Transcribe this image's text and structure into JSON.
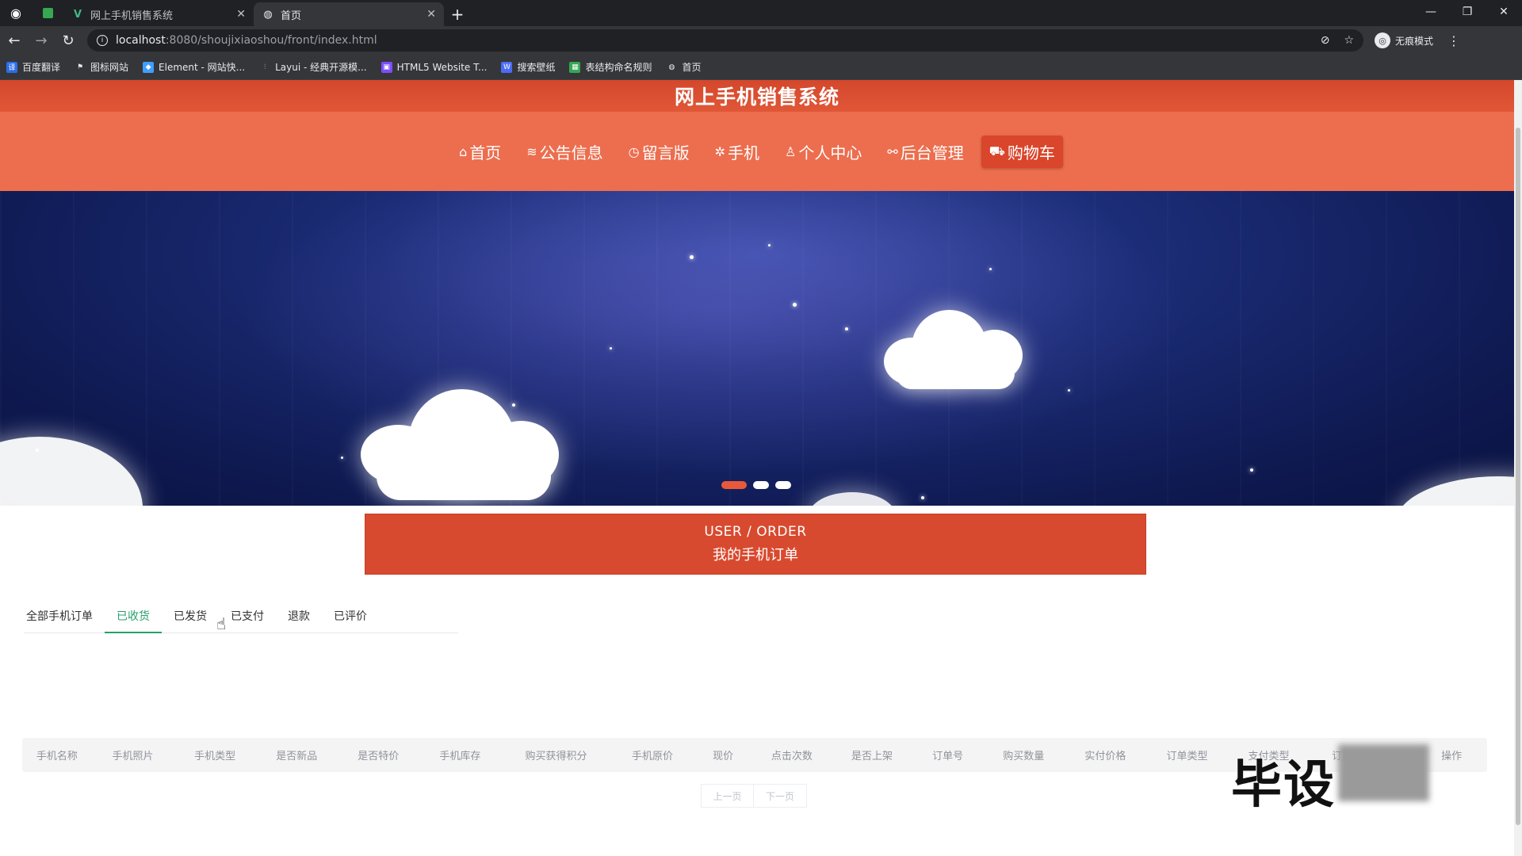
{
  "browser": {
    "tabs": [
      {
        "title": "网上手机销售系统",
        "active": false
      },
      {
        "title": "首页",
        "active": true
      }
    ],
    "url_host": "localhost",
    "url_path": ":8080/shoujixiaoshou/front/index.html",
    "profile_label": "无痕模式",
    "bookmarks": [
      {
        "label": "百度翻译",
        "color": "#2b6de8"
      },
      {
        "label": "图标网站",
        "color": "#e8eaed"
      },
      {
        "label": "Element - 网站快...",
        "color": "#409eff"
      },
      {
        "label": "Layui - 经典开源模...",
        "color": "#5f6368"
      },
      {
        "label": "HTML5 Website T...",
        "color": "#7c4dff"
      },
      {
        "label": "搜索壁纸",
        "color": "#4a6cf7"
      },
      {
        "label": "表结构命名规则",
        "color": "#34a853"
      },
      {
        "label": "首页",
        "color": "#e8eaed"
      }
    ]
  },
  "site": {
    "title": "网上手机销售系统",
    "nav": [
      {
        "icon": "⌂",
        "label": "首页"
      },
      {
        "icon": "≋",
        "label": "公告信息"
      },
      {
        "icon": "◷",
        "label": "留言版"
      },
      {
        "icon": "✲",
        "label": "手机"
      },
      {
        "icon": "♙",
        "label": "个人中心"
      },
      {
        "icon": "⚯",
        "label": "后台管理"
      },
      {
        "icon": "⛟",
        "label": "购物车",
        "active": true
      }
    ]
  },
  "header_box": {
    "en": "USER / ORDER",
    "cn": "我的手机订单"
  },
  "order_tabs": [
    {
      "label": "全部手机订单",
      "active": false
    },
    {
      "label": "已收货",
      "active": true
    },
    {
      "label": "已发货",
      "active": false
    },
    {
      "label": "已支付",
      "active": false
    },
    {
      "label": "退款",
      "active": false
    },
    {
      "label": "已评价",
      "active": false
    }
  ],
  "table": {
    "columns": [
      "手机名称",
      "手机照片",
      "手机类型",
      "是否新品",
      "是否特价",
      "手机库存",
      "购买获得积分",
      "手机原价",
      "现价",
      "点击次数",
      "是否上架",
      "订单号",
      "购买数量",
      "实付价格",
      "订单类型",
      "支付类型",
      "订单创建时间",
      "操作"
    ]
  },
  "pager": {
    "prev": "上一页",
    "next": "下一页"
  },
  "watermark": "毕设",
  "colors": {
    "brand": "#d84a2f",
    "nav_bg": "#ec6e4e",
    "tab_active": "#26a069"
  }
}
